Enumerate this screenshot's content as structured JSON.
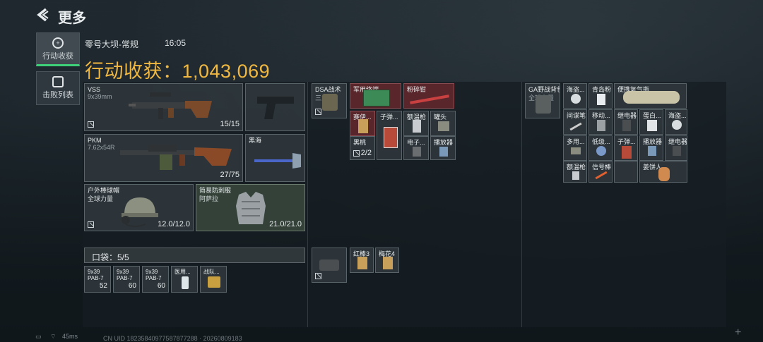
{
  "header": {
    "back_label": "更多"
  },
  "sidebar": {
    "tabs": [
      {
        "label": "行动收获",
        "active": true
      },
      {
        "label": "击败列表",
        "active": false
      }
    ]
  },
  "match": {
    "map": "零号大坝-常规",
    "time": "16:05",
    "total_label": "行动收获：1,043,069"
  },
  "loadout": {
    "primary": {
      "name": "VSS",
      "caliber": "9x39mm",
      "ammo": "15/15"
    },
    "holster": {
      "name": ""
    },
    "secondary": {
      "name": "PKM",
      "caliber": "7.62x54R",
      "ammo": "27/75"
    },
    "melee": {
      "name": "黑海"
    },
    "helmet": {
      "name": "户外棒球帽",
      "sub": "全球力量",
      "durability": "12.0/12.0"
    },
    "armor": {
      "name": "简易防刺服",
      "sub": "阿萨拉",
      "durability": "21.0/21.0"
    },
    "pocket_title": "口袋：5/5",
    "pocket_items": [
      {
        "name": "9x39",
        "sub": "PAB-7",
        "count": "52"
      },
      {
        "name": "9x39",
        "sub": "PAB-7",
        "count": "60"
      },
      {
        "name": "9x39",
        "sub": "PAB-7",
        "count": "60"
      },
      {
        "name": "医用...",
        "sub": "",
        "count": ""
      },
      {
        "name": "战队...",
        "sub": "",
        "count": ""
      }
    ]
  },
  "rig": {
    "name": "DSA战术",
    "sub": "三角...",
    "items": [
      {
        "name": "军用终端",
        "color": "red"
      },
      {
        "name": "粉碎钳",
        "color": "red"
      },
      {
        "name": "赛伊...",
        "color": "red"
      },
      {
        "name": "子弹...",
        "color": ""
      },
      {
        "name": "额温枪",
        "color": ""
      },
      {
        "name": "罐头",
        "color": ""
      },
      {
        "name": "黑桃",
        "color": "",
        "count": "2/2"
      },
      {
        "name": "电子...",
        "color": ""
      },
      {
        "name": "播放器",
        "color": ""
      }
    ],
    "case_items": [
      {
        "name": "红棒3"
      },
      {
        "name": "梅花4"
      }
    ]
  },
  "backpack": {
    "name": "GA野战背包",
    "sub": "全球力量",
    "items": [
      {
        "name": "海盗..."
      },
      {
        "name": "青岛粉"
      },
      {
        "name": "便携氧气瓶"
      },
      {
        "name": "间谍笔"
      },
      {
        "name": "移动..."
      },
      {
        "name": "继电器"
      },
      {
        "name": "蛋白..."
      },
      {
        "name": "海盗..."
      },
      {
        "name": "多用..."
      },
      {
        "name": "低级..."
      },
      {
        "name": "子弹..."
      },
      {
        "name": "播放器"
      },
      {
        "name": "继电器"
      },
      {
        "name": "额温枪"
      },
      {
        "name": "信号棒"
      },
      {
        "name": "姜饼人"
      }
    ]
  },
  "status": {
    "ping": "45ms",
    "uid": "CN UID 18235840977587877288 · 20260809183"
  }
}
